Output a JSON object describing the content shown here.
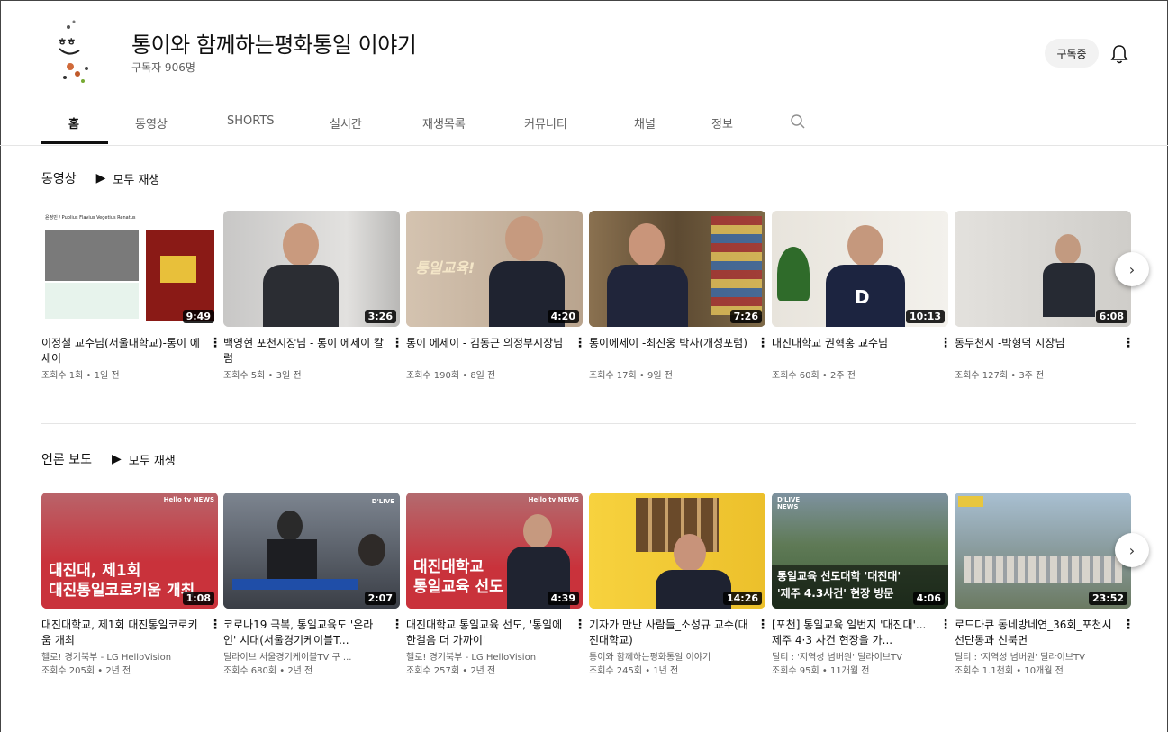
{
  "channel": {
    "name": "통이와 함께하는평화통일 이야기",
    "subscribers": "구독자 906명",
    "subscribe_button": "구독중"
  },
  "tabs": [
    {
      "label": "홈"
    },
    {
      "label": "동영상"
    },
    {
      "label": "SHORTS"
    },
    {
      "label": "실시간"
    },
    {
      "label": "재생목록"
    },
    {
      "label": "커뮤니티"
    },
    {
      "label": "채널"
    },
    {
      "label": "정보"
    }
  ],
  "shelves": [
    {
      "title": "동영상",
      "play_all": "모두 재생",
      "videos": [
        {
          "title": "이정철 교수님(서울대학교)-통이 에세이",
          "meta": "조회수 1회 • 1일 전",
          "channel": "",
          "duration": "9:49",
          "thumb_text": "윤정민 / Publius Flavius Vegetius Renatus"
        },
        {
          "title": "백영현 포천시장님 - 통이 에세이 칼럼",
          "meta": "조회수 5회 • 3일 전",
          "channel": "",
          "duration": "3:26",
          "thumb_text": ""
        },
        {
          "title": "통이 에세이 - 김동근 의정부시장님",
          "meta": "조회수 190회 • 8일 전",
          "channel": "",
          "duration": "4:20",
          "thumb_text": "통일교육!"
        },
        {
          "title": "통이에세이 -최진웅 박사(개성포럼)",
          "meta": "조회수 17회 • 9일 전",
          "channel": "",
          "duration": "7:26",
          "thumb_text": ""
        },
        {
          "title": "대진대학교 권혁홍 교수님",
          "meta": "조회수 60회 • 2주 전",
          "channel": "",
          "duration": "10:13",
          "thumb_text": "D"
        },
        {
          "title": "동두천시 -박형덕 시장님",
          "meta": "조회수 127회 • 3주 전",
          "channel": "",
          "duration": "6:08",
          "thumb_text": ""
        }
      ]
    },
    {
      "title": "언론 보도",
      "play_all": "모두 재생",
      "videos": [
        {
          "title": "대진대학교, 제1회 대진통일코로키움 개최",
          "channel": "헬로! 경기북부 - LG HelloVision",
          "meta": "조회수 205회 • 2년 전",
          "duration": "1:08",
          "thumb_text": "대진대, 제1회|대진통일코로키움 개최",
          "badge": "Hello tv NEWS"
        },
        {
          "title": "코로나19 극복, 통일교육도 '온라인' 시대(서울경기케이블T...",
          "channel": "딜라이브 서울경기케이블TV 구 ...",
          "meta": "조회수 680회 • 2년 전",
          "duration": "2:07",
          "thumb_text": "",
          "badge": "D'LIVE"
        },
        {
          "title": "대진대학교 통일교육 선도, '통일에 한걸음 더 가까이'",
          "channel": "헬로! 경기북부 - LG HelloVision",
          "meta": "조회수 257회 • 2년 전",
          "duration": "4:39",
          "thumb_text": "대진대학교|통일교육 선도",
          "badge": "Hello tv NEWS"
        },
        {
          "title": "기자가 만난 사람들_소성규 교수(대진대학교)",
          "channel": "통이와 함께하는평화통일 이야기",
          "meta": "조회수 245회 • 1년 전",
          "duration": "14:26",
          "thumb_text": ""
        },
        {
          "title": "[포천] 통일교육 일번지 '대진대'...제주 4·3 사건 현장을 가...",
          "channel": "딜티 : '지역성 넘버원' 딜라이브TV",
          "meta": "조회수 95회 • 11개월 전",
          "duration": "4:06",
          "thumb_text": "통일교육 선도대학 '대진대'|'제주 4.3사건' 현장 방문",
          "badge": "D'LIVE NEWS"
        },
        {
          "title": "로드다큐 동네방네연_36회_포천시 선단동과 신북면",
          "channel": "딜티 : '지역성 넘버원' 딜라이브TV",
          "meta": "조회수 1.1천회 • 10개월 전",
          "duration": "23:52",
          "thumb_text": ""
        }
      ]
    }
  ],
  "colors": {
    "accent_dark": "#0f0f0f",
    "meta_gray": "#606060",
    "red_thumb": "#c9323b",
    "yellow_thumb": "#f7d23e"
  }
}
